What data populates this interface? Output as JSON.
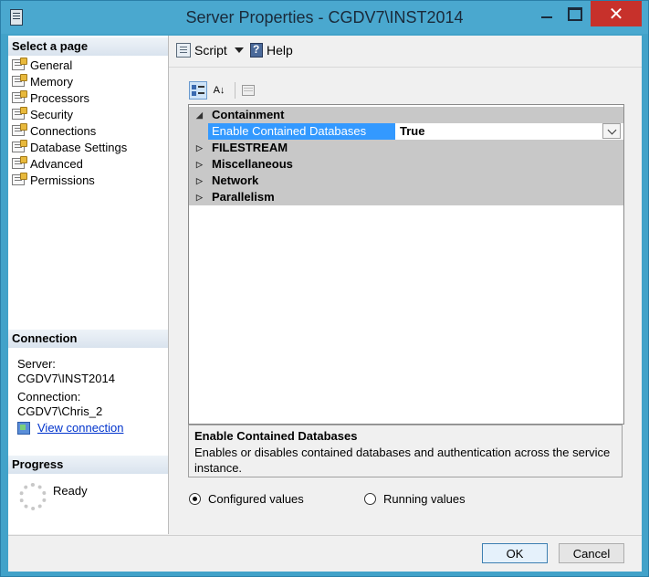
{
  "window": {
    "title": "Server Properties - CGDV7\\INST2014",
    "close_glyph": "✕"
  },
  "left": {
    "select_header": "Select a page",
    "pages": [
      "General",
      "Memory",
      "Processors",
      "Security",
      "Connections",
      "Database Settings",
      "Advanced",
      "Permissions"
    ],
    "connection_header": "Connection",
    "server_label": "Server:",
    "server_value": "CGDV7\\INST2014",
    "connection_label": "Connection:",
    "connection_value": "CGDV7\\Chris_2",
    "view_connection": "View connection",
    "progress_header": "Progress",
    "progress_status": "Ready"
  },
  "toolbar": {
    "script": "Script",
    "help": "Help",
    "sort_icon_text": "A↓"
  },
  "grid": {
    "expanded_glyph": "◢",
    "collapsed_glyph": "▷",
    "categories": [
      {
        "name": "Containment",
        "expanded": true
      },
      {
        "name": "FILESTREAM",
        "expanded": false
      },
      {
        "name": "Miscellaneous",
        "expanded": false
      },
      {
        "name": "Network",
        "expanded": false
      },
      {
        "name": "Parallelism",
        "expanded": false
      }
    ],
    "selected_property": {
      "name": "Enable Contained Databases",
      "value": "True"
    }
  },
  "description": {
    "title": "Enable Contained Databases",
    "text": "Enables or disables contained databases and authentication across the service instance."
  },
  "view_options": {
    "configured": "Configured values",
    "running": "Running values",
    "selected": "configured"
  },
  "buttons": {
    "ok": "OK",
    "cancel": "Cancel"
  },
  "colors": {
    "selection": "#3399ff",
    "titlebar": "#4aa8cf",
    "close": "#c7312b",
    "category": "#c8c8c8"
  }
}
